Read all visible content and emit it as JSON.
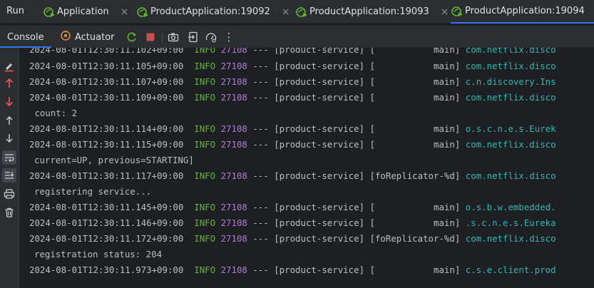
{
  "run_panel": {
    "title": "Run",
    "tabs": [
      {
        "label": "Application",
        "close": "×"
      },
      {
        "label": "ProductApplication:19092",
        "close": "×"
      },
      {
        "label": "ProductApplication:19093",
        "close": "×"
      },
      {
        "label": "ProductApplication:19094",
        "close": "×"
      }
    ]
  },
  "toolbar": {
    "console_label": "Console",
    "actuator_label": "Actuator",
    "more": "⋮"
  },
  "log_lines": [
    {
      "ts": "2024-08-01T12:30:11.102+09:00",
      "level": "INFO",
      "pid": "27108",
      "sep": " --- ",
      "service": "[product-service] [",
      "thread": "           main] ",
      "logger": "com.netflix.disco"
    },
    {
      "ts": "2024-08-01T12:30:11.105+09:00",
      "level": "INFO",
      "pid": "27108",
      "sep": " --- ",
      "service": "[product-service] [",
      "thread": "           main] ",
      "logger": "com.netflix.disco"
    },
    {
      "ts": "2024-08-01T12:30:11.107+09:00",
      "level": "INFO",
      "pid": "27108",
      "sep": " --- ",
      "service": "[product-service] [",
      "thread": "           main] ",
      "logger": "c.n.discovery.Ins"
    },
    {
      "ts": "2024-08-01T12:30:11.109+09:00",
      "level": "INFO",
      "pid": "27108",
      "sep": " --- ",
      "service": "[product-service] [",
      "thread": "           main] ",
      "logger": "com.netflix.disco"
    },
    {
      "cont": " count: 2"
    },
    {
      "ts": "2024-08-01T12:30:11.114+09:00",
      "level": "INFO",
      "pid": "27108",
      "sep": " --- ",
      "service": "[product-service] [",
      "thread": "           main] ",
      "logger": "o.s.c.n.e.s.Eurek"
    },
    {
      "ts": "2024-08-01T12:30:11.115+09:00",
      "level": "INFO",
      "pid": "27108",
      "sep": " --- ",
      "service": "[product-service] [",
      "thread": "           main] ",
      "logger": "com.netflix.disco"
    },
    {
      "cont": "current=UP, previous=STARTING]"
    },
    {
      "ts": "2024-08-01T12:30:11.117+09:00",
      "level": "INFO",
      "pid": "27108",
      "sep": " --- ",
      "service": "[product-service] [",
      "thread": "foReplicator-%d] ",
      "logger": "com.netflix.disco"
    },
    {
      "cont": "registering service..."
    },
    {
      "ts": "2024-08-01T12:30:11.145+09:00",
      "level": "INFO",
      "pid": "27108",
      "sep": " --- ",
      "service": "[product-service] [",
      "thread": "           main] ",
      "logger": "o.s.b.w.embedded."
    },
    {
      "ts": "2024-08-01T12:30:11.146+09:00",
      "level": "INFO",
      "pid": "27108",
      "sep": " --- ",
      "service": "[product-service] [",
      "thread": "           main] ",
      "logger": ".s.c.n.e.s.Eureka"
    },
    {
      "ts": "2024-08-01T12:30:11.172+09:00",
      "level": "INFO",
      "pid": "27108",
      "sep": " --- ",
      "service": "[product-service] [",
      "thread": "foReplicator-%d] ",
      "logger": "com.netflix.disco"
    },
    {
      "cont": "registration status: 204"
    },
    {
      "ts": "2024-08-01T12:30:11.973+09:00",
      "level": "INFO",
      "pid": "27108",
      "sep": " --- ",
      "service": "[product-service] [",
      "thread": "           main] ",
      "logger": "c.s.e.client.prod"
    }
  ],
  "colors": {
    "accent": "#3574f0",
    "info": "#5fb832",
    "pid": "#b07bd8",
    "logger": "#2fb8b0",
    "stop": "#c94f4f"
  }
}
